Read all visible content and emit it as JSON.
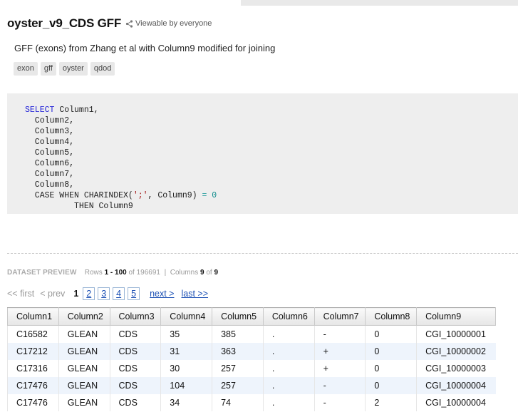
{
  "dataset": {
    "title": "oyster_v9_CDS GFF",
    "sharing": "Viewable by everyone",
    "description": "GFF (exons) from Zhang et al with Column9 modified for joining",
    "tags": [
      "exon",
      "gff",
      "oyster",
      "qdod"
    ]
  },
  "query": {
    "lines": [
      [
        [
          "kw",
          "SELECT"
        ],
        [
          "t",
          " Column1,"
        ]
      ],
      [
        [
          "t",
          "  Column2,"
        ]
      ],
      [
        [
          "t",
          "  Column3,"
        ]
      ],
      [
        [
          "t",
          "  Column4,"
        ]
      ],
      [
        [
          "t",
          "  Column5,"
        ]
      ],
      [
        [
          "t",
          "  Column6,"
        ]
      ],
      [
        [
          "t",
          "  Column7,"
        ]
      ],
      [
        [
          "t",
          "  Column8,"
        ]
      ],
      [
        [
          "t",
          "  CASE WHEN CHARINDEX("
        ],
        [
          "str",
          "';'"
        ],
        [
          "t",
          ", Column9) "
        ],
        [
          "op",
          "="
        ],
        [
          "t",
          " "
        ],
        [
          "num",
          "0"
        ]
      ],
      [
        [
          "t",
          "          THEN Column9"
        ]
      ]
    ]
  },
  "preview": {
    "label": "DATASET PREVIEW",
    "rows_prefix": "Rows",
    "rows_start": "1",
    "rows_dash": "-",
    "rows_end": "100",
    "rows_of": "of 196691",
    "divider": "|",
    "columns_prefix": "Columns",
    "columns_shown": "9",
    "columns_of": "of",
    "columns_total": "9"
  },
  "pagination": {
    "first": "<< first",
    "prev": "< prev",
    "current": "1",
    "pages": [
      "2",
      "3",
      "4",
      "5"
    ],
    "next": "next >",
    "last": "last >>"
  },
  "table": {
    "columns": [
      "Column1",
      "Column2",
      "Column3",
      "Column4",
      "Column5",
      "Column6",
      "Column7",
      "Column8",
      "Column9"
    ],
    "rows": [
      [
        "C16582",
        "GLEAN",
        "CDS",
        "35",
        "385",
        ".",
        "-",
        "0",
        "CGI_10000001"
      ],
      [
        "C17212",
        "GLEAN",
        "CDS",
        "31",
        "363",
        ".",
        "+",
        "0",
        "CGI_10000002"
      ],
      [
        "C17316",
        "GLEAN",
        "CDS",
        "30",
        "257",
        ".",
        "+",
        "0",
        "CGI_10000003"
      ],
      [
        "C17476",
        "GLEAN",
        "CDS",
        "104",
        "257",
        ".",
        "-",
        "0",
        "CGI_10000004"
      ],
      [
        "C17476",
        "GLEAN",
        "CDS",
        "34",
        "74",
        ".",
        "-",
        "2",
        "CGI_10000004"
      ]
    ]
  },
  "icons": {
    "share": "share-icon"
  },
  "colors": {
    "link": "#1a4fb4",
    "keyword": "#2424d8",
    "row_alt": "#eef4fc"
  }
}
